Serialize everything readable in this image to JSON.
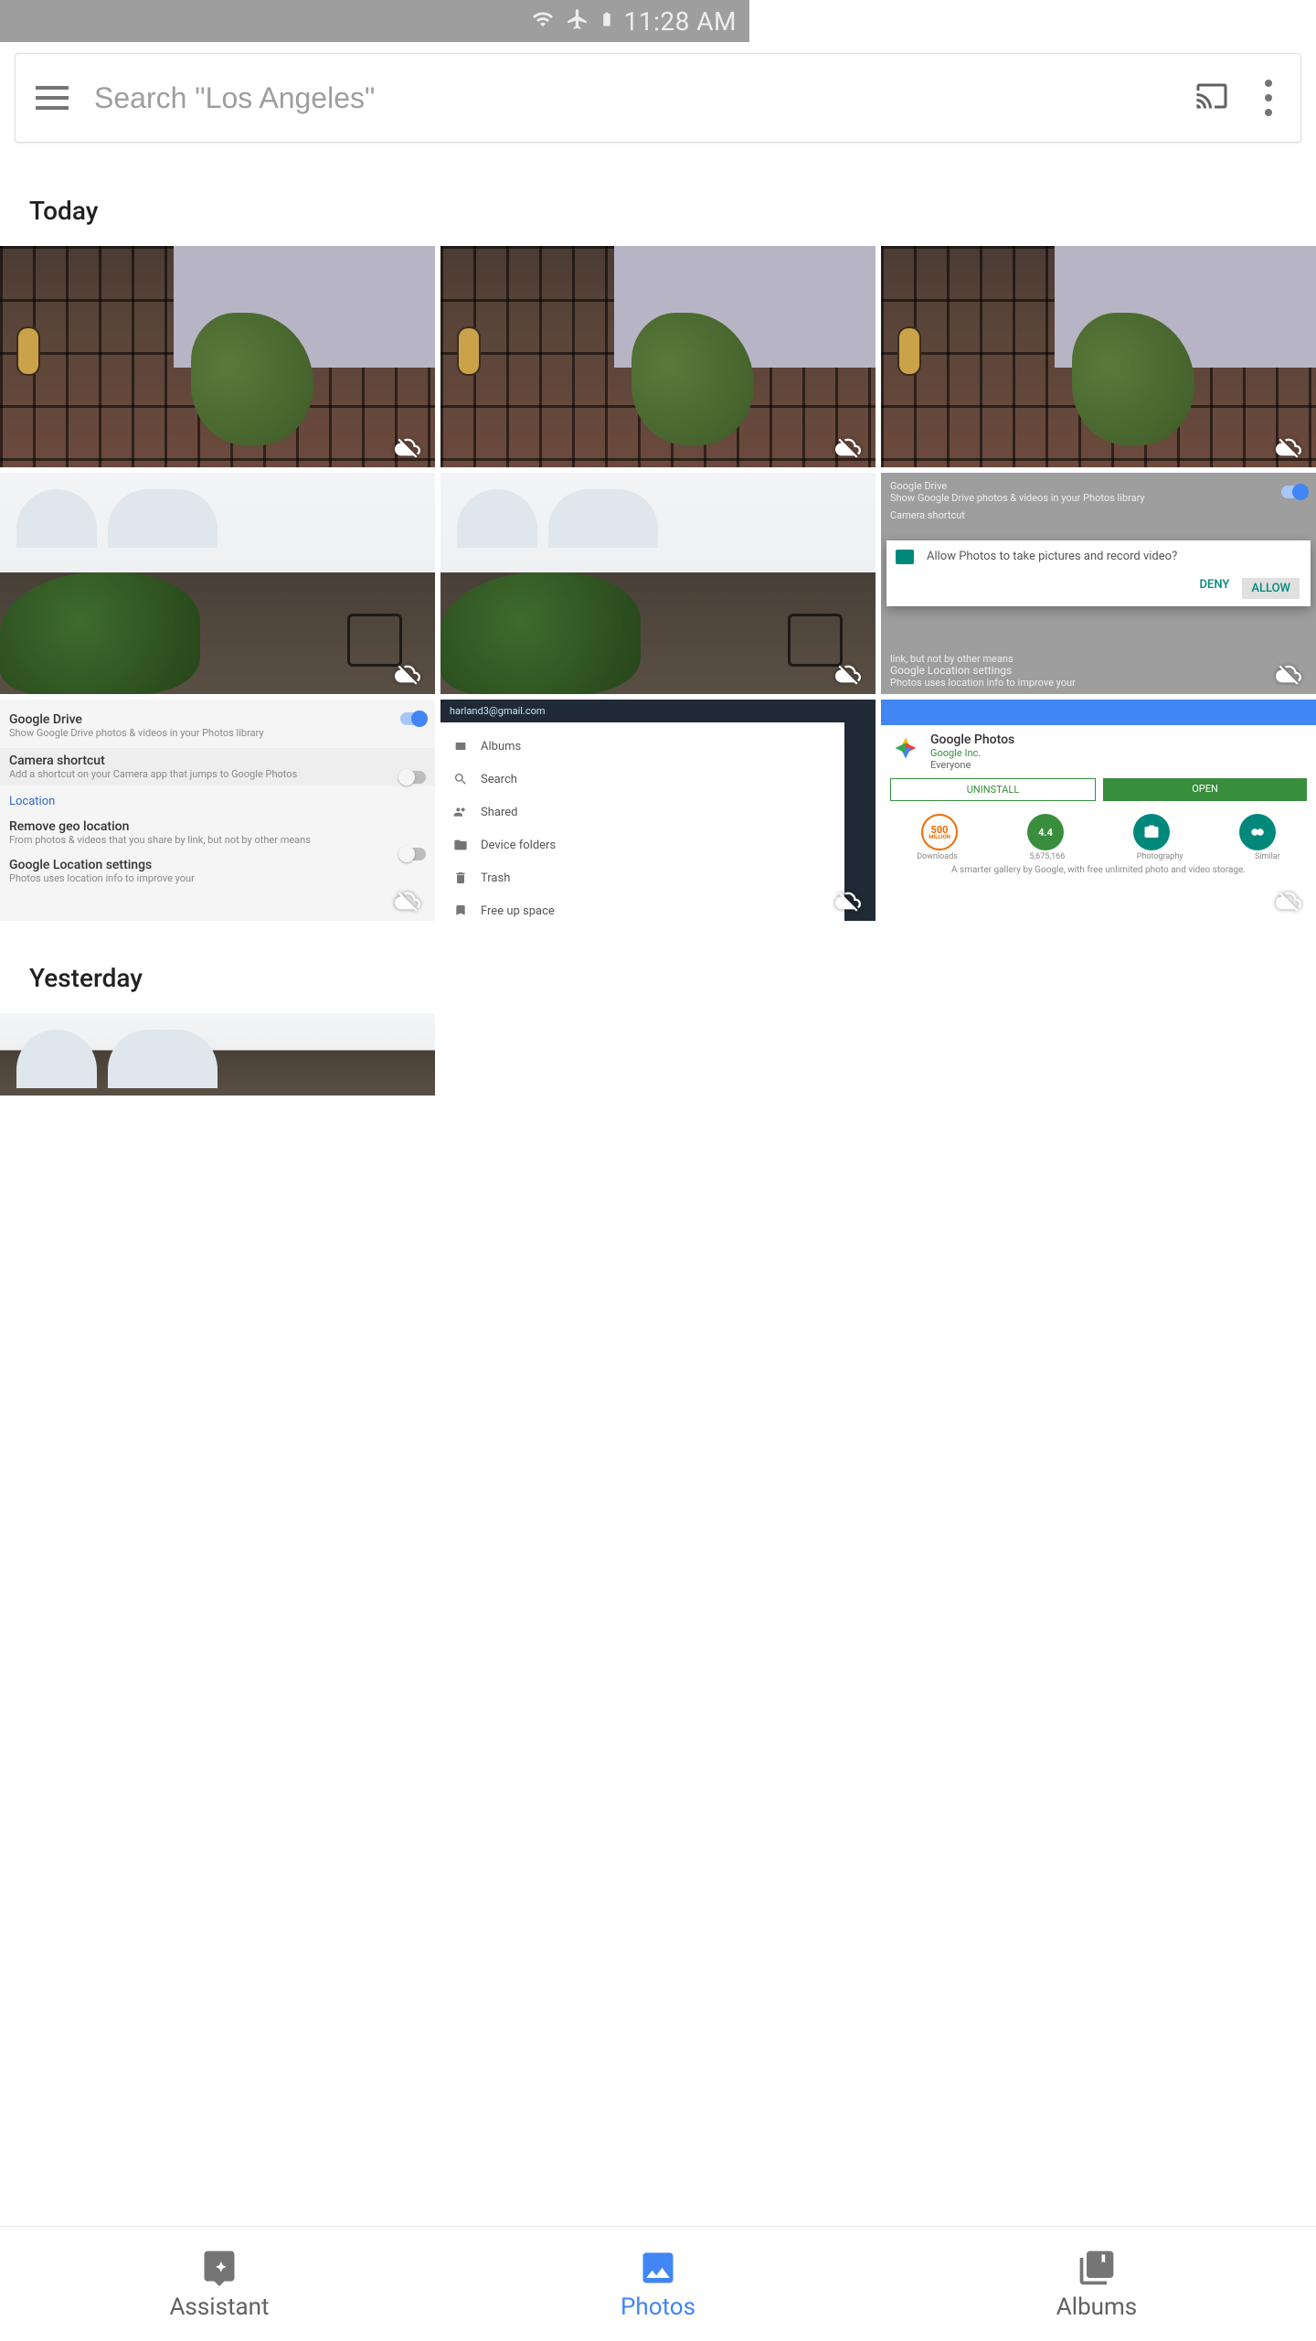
{
  "status_bar": {
    "time": "11:28 AM"
  },
  "search": {
    "placeholder": "Search \"Los Angeles\""
  },
  "sections": {
    "today": "Today",
    "yesterday": "Yesterday"
  },
  "thumbs": {
    "ss_settings": {
      "drive_title": "Google Drive",
      "drive_sub": "Show Google Drive photos & videos in your Photos library",
      "cam_title": "Camera shortcut",
      "cam_sub": "Add a shortcut on your Camera app that jumps to Google Photos",
      "location": "Location",
      "remove_title": "Remove geo location",
      "remove_sub": "From photos & videos that you share by link, but not by other means",
      "gls_title": "Google Location settings",
      "gls_sub": "Photos uses location info to improve your"
    },
    "ss_dialog": {
      "drive_title": "Google Drive",
      "drive_sub": "Show Google Drive photos & videos in your Photos library",
      "cam_title": "Camera shortcut",
      "msg": "Allow Photos to take pictures and record video?",
      "deny": "DENY",
      "allow": "ALLOW",
      "remove_sub": "link, but not by other means",
      "gls_title": "Google Location settings",
      "gls_sub": "Photos uses location info to improve your"
    },
    "ss_nav": {
      "email": "harland3@gmail.com",
      "items": [
        "Albums",
        "Search",
        "Shared",
        "Device folders",
        "Trash",
        "Free up space"
      ]
    },
    "ss_play": {
      "name": "Google Photos",
      "vendor": "Google Inc.",
      "rating_tag": "Everyone",
      "uninstall": "UNINSTALL",
      "open": "OPEN",
      "b1": "500",
      "b1s": "MILLION",
      "b2": "4.4",
      "l1": "Downloads",
      "l2": "5,675,166",
      "l3": "Photography",
      "l4": "Similar",
      "tag": "A smarter gallery by Google, with free unlimited photo and video storage."
    }
  },
  "nav": {
    "assistant": "Assistant",
    "photos": "Photos",
    "albums": "Albums"
  }
}
